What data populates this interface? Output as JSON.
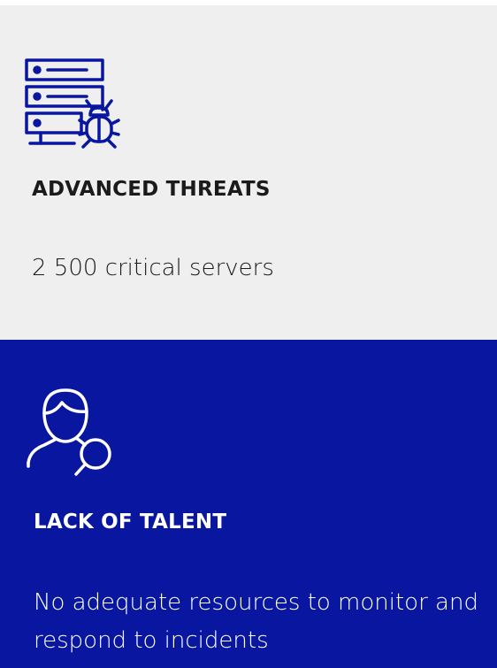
{
  "colors": {
    "card_light_bg": "#efefef",
    "card_dark_bg": "#0917a0",
    "accent_blue": "#0917a0",
    "dark_text": "#1b1b1b",
    "light_text": "#ffffff"
  },
  "cards": [
    {
      "icon": "server-bug-icon",
      "title": "ADVANCED THREATS",
      "text": "2 500 critical servers"
    },
    {
      "icon": "person-search-icon",
      "title": "LACK OF TALENT",
      "text": "No adequate resources to monitor and respond to incidents"
    }
  ]
}
